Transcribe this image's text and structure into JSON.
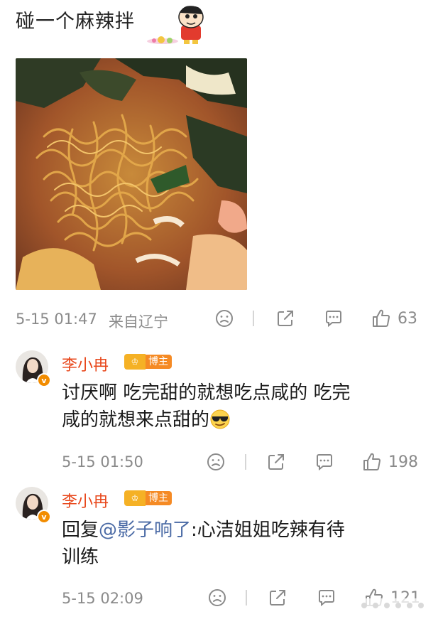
{
  "post": {
    "title": "碰一个麻辣拌",
    "time": "5-15 01:47",
    "source": "来自辽宁",
    "likes": "63"
  },
  "comments": [
    {
      "username": "李小冉",
      "badge": "博主",
      "text_line1": "讨厌啊 吃完甜的就想吃点咸的 吃完",
      "text_line2": "咸的就想来点甜的",
      "emoji": "sunglasses-emoji",
      "time": "5-15 01:50",
      "likes": "198"
    },
    {
      "username": "李小冉",
      "badge": "博主",
      "reply_prefix": "回复",
      "mention": "@影子响了",
      "text_after": ":心洁姐姐吃辣有待",
      "text_line2": "训练",
      "time": "5-15 02:09",
      "likes": "121"
    }
  ],
  "icons": {
    "dislike": "frown-icon",
    "share": "share-icon",
    "comment": "comment-icon",
    "like": "thumbs-up-icon",
    "verified": "verified-v-badge"
  },
  "colors": {
    "username": "#e8471b",
    "mention": "#4a6aa5",
    "meta": "#8a8a8a"
  }
}
